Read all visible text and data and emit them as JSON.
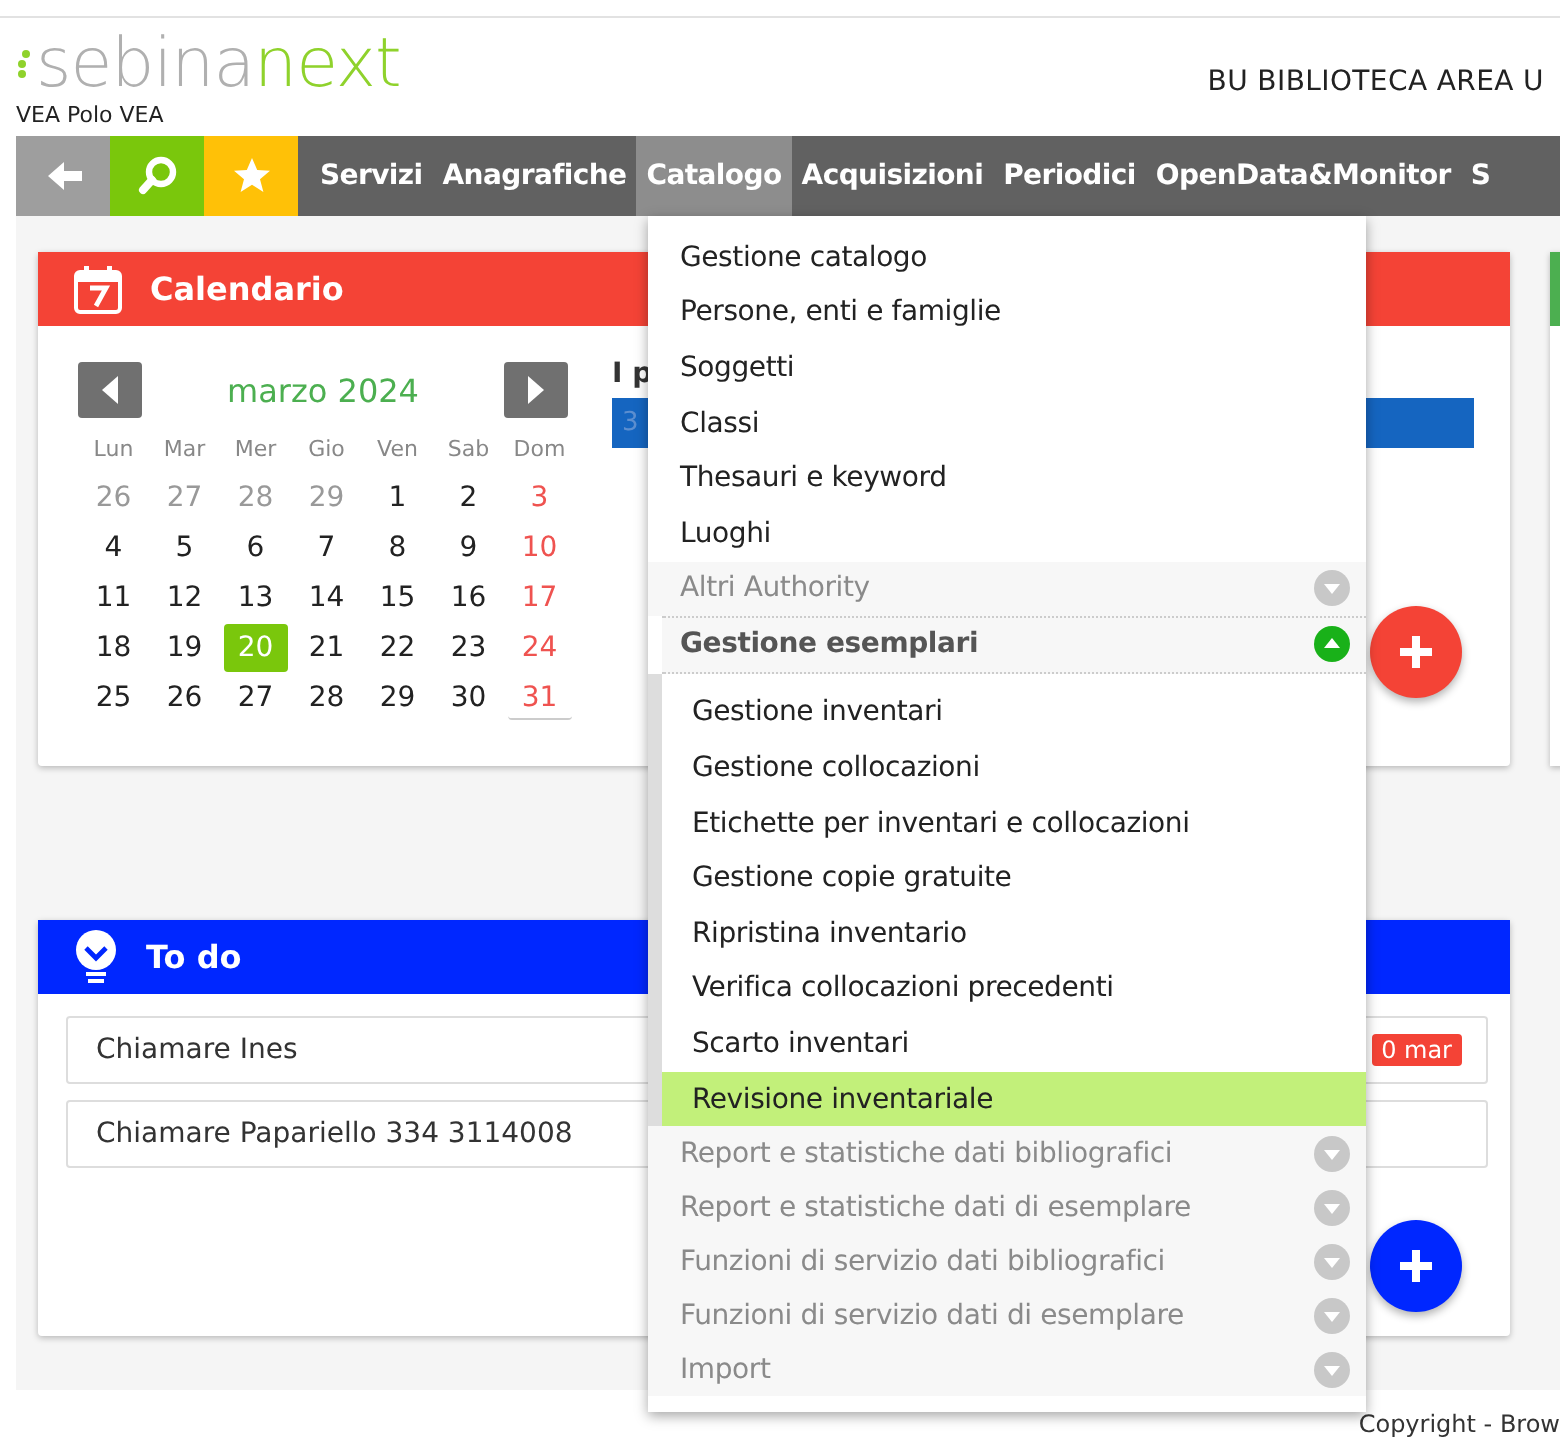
{
  "header": {
    "logo_light": "sebina",
    "logo_accent": "next",
    "subtitle": "VEA Polo VEA",
    "library": "BU BIBLIOTECA AREA U"
  },
  "nav": {
    "tools": [
      {
        "kind": "back"
      },
      {
        "kind": "search"
      },
      {
        "kind": "star"
      }
    ],
    "items": [
      {
        "label": "Servizi",
        "selected": false
      },
      {
        "label": "Anagrafiche",
        "selected": false
      },
      {
        "label": "Catalogo",
        "selected": true
      },
      {
        "label": "Acquisizioni",
        "selected": false
      },
      {
        "label": "Periodici",
        "selected": false
      },
      {
        "label": "OpenData&Monitor",
        "selected": false
      },
      {
        "label": "S",
        "selected": false
      }
    ]
  },
  "calendar": {
    "title": "Calendario",
    "month": "marzo 2024",
    "weekdays": [
      "Lun",
      "Mar",
      "Mer",
      "Gio",
      "Ven",
      "Sab",
      "Dom"
    ],
    "days": [
      {
        "label": "26",
        "kind": "outside",
        "selected": false,
        "marked": false
      },
      {
        "label": "27",
        "kind": "outside",
        "selected": false,
        "marked": false
      },
      {
        "label": "28",
        "kind": "outside",
        "selected": false,
        "marked": false
      },
      {
        "label": "29",
        "kind": "outside",
        "selected": false,
        "marked": false
      },
      {
        "label": "1",
        "kind": "weekday",
        "selected": false,
        "marked": false
      },
      {
        "label": "2",
        "kind": "weekday",
        "selected": false,
        "marked": false
      },
      {
        "label": "3",
        "kind": "sunday",
        "selected": false,
        "marked": false
      },
      {
        "label": "4",
        "kind": "weekday",
        "selected": false,
        "marked": false
      },
      {
        "label": "5",
        "kind": "weekday",
        "selected": false,
        "marked": false
      },
      {
        "label": "6",
        "kind": "weekday",
        "selected": false,
        "marked": false
      },
      {
        "label": "7",
        "kind": "weekday",
        "selected": false,
        "marked": false
      },
      {
        "label": "8",
        "kind": "weekday",
        "selected": false,
        "marked": false
      },
      {
        "label": "9",
        "kind": "weekday",
        "selected": false,
        "marked": false
      },
      {
        "label": "10",
        "kind": "sunday",
        "selected": false,
        "marked": false
      },
      {
        "label": "11",
        "kind": "weekday",
        "selected": false,
        "marked": false
      },
      {
        "label": "12",
        "kind": "weekday",
        "selected": false,
        "marked": false
      },
      {
        "label": "13",
        "kind": "weekday",
        "selected": false,
        "marked": false
      },
      {
        "label": "14",
        "kind": "weekday",
        "selected": false,
        "marked": false
      },
      {
        "label": "15",
        "kind": "weekday",
        "selected": false,
        "marked": false
      },
      {
        "label": "16",
        "kind": "weekday",
        "selected": false,
        "marked": false
      },
      {
        "label": "17",
        "kind": "sunday",
        "selected": false,
        "marked": false
      },
      {
        "label": "18",
        "kind": "weekday",
        "selected": false,
        "marked": false
      },
      {
        "label": "19",
        "kind": "weekday",
        "selected": false,
        "marked": false
      },
      {
        "label": "20",
        "kind": "weekday",
        "selected": true,
        "marked": false
      },
      {
        "label": "21",
        "kind": "weekday",
        "selected": false,
        "marked": false
      },
      {
        "label": "22",
        "kind": "weekday",
        "selected": false,
        "marked": false
      },
      {
        "label": "23",
        "kind": "weekday",
        "selected": false,
        "marked": false
      },
      {
        "label": "24",
        "kind": "sunday",
        "selected": false,
        "marked": false
      },
      {
        "label": "25",
        "kind": "weekday",
        "selected": false,
        "marked": false
      },
      {
        "label": "26",
        "kind": "weekday",
        "selected": false,
        "marked": false
      },
      {
        "label": "27",
        "kind": "weekday",
        "selected": false,
        "marked": false
      },
      {
        "label": "28",
        "kind": "weekday",
        "selected": false,
        "marked": false
      },
      {
        "label": "29",
        "kind": "weekday",
        "selected": false,
        "marked": false
      },
      {
        "label": "30",
        "kind": "weekday",
        "selected": false,
        "marked": false
      },
      {
        "label": "31",
        "kind": "sunday",
        "selected": false,
        "marked": true
      }
    ],
    "side_heading": "I p",
    "event_label": "3"
  },
  "todo": {
    "title": "To do",
    "tasks": [
      {
        "text": "Chiamare Ines",
        "badge": "0 mar"
      },
      {
        "text": "Chiamare Papariello 334 3114008"
      }
    ]
  },
  "menu": {
    "items": [
      {
        "kind": "link",
        "label": "Gestione catalogo",
        "selected": false
      },
      {
        "kind": "link",
        "label": "Persone, enti e famiglie",
        "selected": false
      },
      {
        "kind": "link",
        "label": "Soggetti",
        "selected": false
      },
      {
        "kind": "link",
        "label": "Classi",
        "selected": false
      },
      {
        "kind": "link",
        "label": "Thesauri e keyword",
        "selected": false
      },
      {
        "kind": "link",
        "label": "Luoghi",
        "selected": false
      },
      {
        "kind": "group",
        "label": "Altri Authority",
        "expanded": false
      },
      {
        "kind": "group",
        "label": "Gestione esemplari",
        "expanded": true,
        "children": [
          {
            "label": "Gestione inventari",
            "selected": false
          },
          {
            "label": "Gestione collocazioni",
            "selected": false
          },
          {
            "label": "Etichette per inventari e collocazioni",
            "selected": false
          },
          {
            "label": "Gestione copie gratuite",
            "selected": false
          },
          {
            "label": "Ripristina inventario",
            "selected": false
          },
          {
            "label": "Verifica collocazioni precedenti",
            "selected": false
          },
          {
            "label": "Scarto inventari",
            "selected": false
          },
          {
            "label": "Revisione inventariale",
            "selected": true
          }
        ]
      },
      {
        "kind": "group",
        "label": "Report e statistiche dati bibliografici",
        "expanded": false
      },
      {
        "kind": "group",
        "label": "Report e statistiche dati di esemplare",
        "expanded": false
      },
      {
        "kind": "group",
        "label": "Funzioni di servizio dati bibliografici",
        "expanded": false
      },
      {
        "kind": "group",
        "label": "Funzioni di servizio dati di esemplare",
        "expanded": false
      },
      {
        "kind": "group",
        "label": "Import",
        "expanded": false
      }
    ]
  },
  "footer": {
    "text": "Copyright - Brow"
  }
}
